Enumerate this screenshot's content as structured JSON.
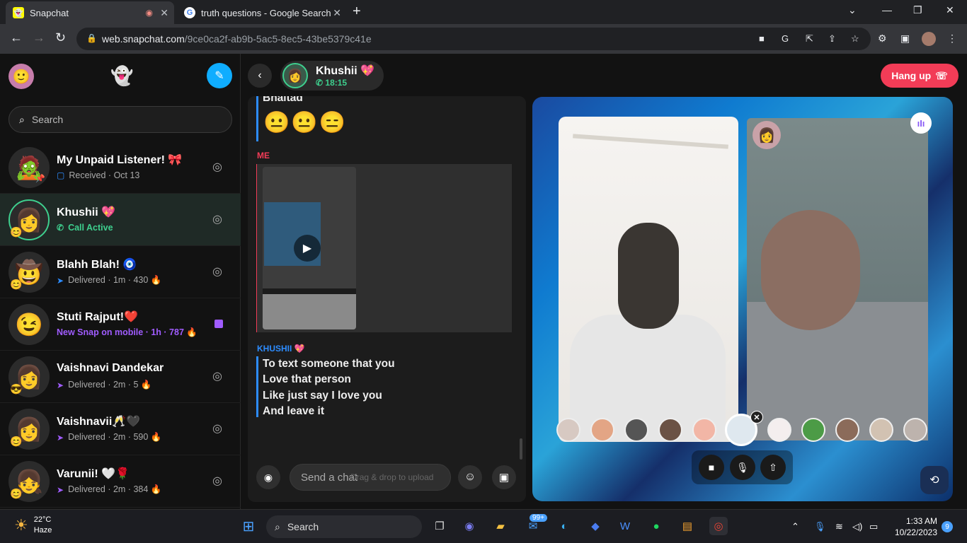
{
  "browser": {
    "tabs": [
      {
        "title": "Snapchat"
      },
      {
        "title": "truth questions - Google Search"
      }
    ],
    "url_host": "web.snapchat.com",
    "url_path": "/9ce0ca2f-ab9b-5ac5-8ec5-43be5379c41e"
  },
  "sidebar": {
    "search_placeholder": "Search",
    "chats": [
      {
        "name": "My Unpaid Listener! 🎀",
        "status": "Received · Oct 13",
        "status_icon": "chat-outline-icon",
        "status_color": "#2d8cff",
        "emoji": "",
        "avatar": "🧟"
      },
      {
        "name": "Khushii 💖",
        "status": "Call Active",
        "status_icon": "phone-icon",
        "status_color": "#3ecf8e",
        "emoji": "😊",
        "avatar": "👩"
      },
      {
        "name": "Blahh Blah! 🧿",
        "status": "Delivered · 1m · 430 🔥",
        "status_icon": "arrow-sent-icon",
        "status_color": "#2d8cff",
        "emoji": "😊",
        "avatar": "🤠"
      },
      {
        "name": "Stuti Rajput!❤️",
        "status": "New Snap on mobile · 1h · 787 🔥",
        "status_icon": "",
        "status_color": "#a05cff",
        "emoji": "",
        "avatar": "😉"
      },
      {
        "name": "Vaishnavi Dandekar",
        "status": "Delivered · 2m · 5 🔥",
        "status_icon": "arrow-sent-icon",
        "status_color": "#a05cff",
        "emoji": "😎",
        "avatar": "👩"
      },
      {
        "name": "Vaishnavii🥂🖤",
        "status": "Delivered · 2m · 590 🔥",
        "status_icon": "arrow-sent-icon",
        "status_color": "#a05cff",
        "emoji": "😊",
        "avatar": "👩"
      },
      {
        "name": "Varunii! 🤍🌹",
        "status": "Delivered · 2m · 384 🔥",
        "status_icon": "arrow-sent-icon",
        "status_color": "#a05cff",
        "emoji": "😊",
        "avatar": "👧"
      }
    ]
  },
  "conversation": {
    "peer_name": "Khushii 💖",
    "call_timer": "18:15",
    "hangup_label": "Hang up",
    "partial_line": "Bhaitad",
    "emoji_line": "😐😐😑",
    "me_label": "ME",
    "khushi_label": "KHUSHII 💖",
    "khushi_lines": [
      "To text someone that you",
      "Love that person",
      "Like just say I love you",
      "And leave it"
    ],
    "composer_placeholder": "Send a chat",
    "composer_hint": "Drag & drop to upload"
  },
  "taskbar": {
    "temp": "22°C",
    "weather": "Haze",
    "search_label": "Search",
    "badge": "99+",
    "time": "1:33 AM",
    "date": "10/22/2023",
    "notif_count": "9"
  }
}
